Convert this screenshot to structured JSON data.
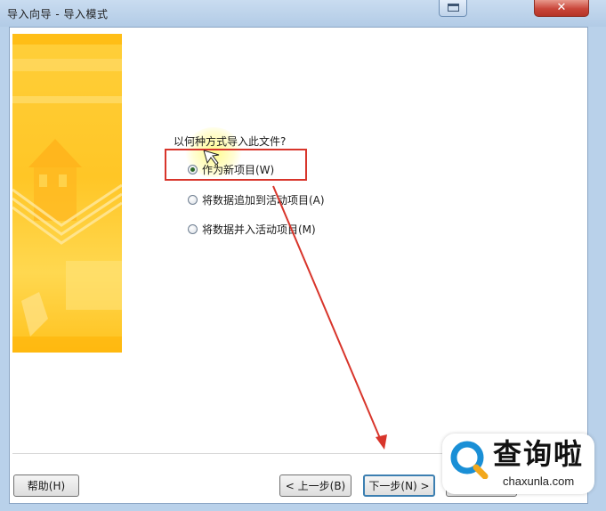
{
  "window": {
    "title": "导入向导 - 导入模式",
    "close_glyph": "✕"
  },
  "wizard": {
    "question": "以何种方式导入此文件?",
    "options": [
      {
        "label": "作为新项目(W)",
        "checked": true
      },
      {
        "label": "将数据追加到活动项目(A)",
        "checked": false
      },
      {
        "label": "将数据并入活动项目(M)",
        "checked": false
      }
    ]
  },
  "buttons": {
    "help": "帮助(H)",
    "back": "< 上一步(B)",
    "next": "下一步(N) >"
  },
  "watermark": {
    "name": "查询啦",
    "url": "chaxunla.com"
  },
  "colors": {
    "annotation_red": "#d8352b",
    "banner_yellow": "#ffc626",
    "close_red": "#c9463a",
    "watermark_blue": "#1a8fd6"
  }
}
